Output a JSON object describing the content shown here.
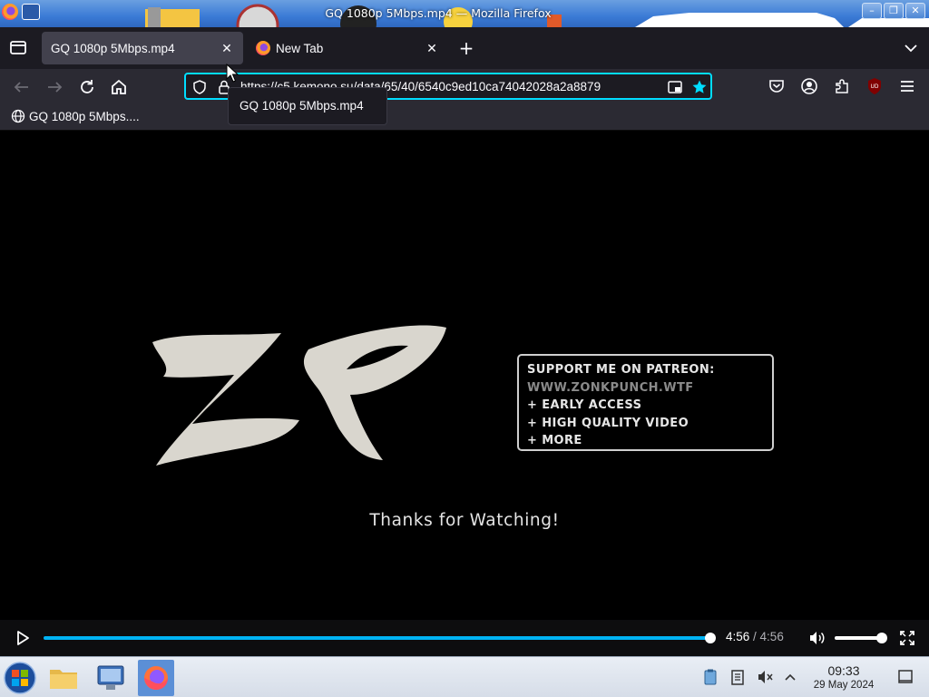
{
  "window": {
    "title": "GQ 1080p 5Mbps.mp4 — Mozilla Firefox",
    "buttons": [
      "minimize",
      "maximize",
      "close"
    ]
  },
  "tabs": [
    {
      "label": "GQ 1080p 5Mbps.mp4",
      "active": true
    },
    {
      "label": "New Tab",
      "active": false
    }
  ],
  "navbar": {
    "url": "https://c5.kemono.su/data/65/40/6540c9ed10ca74042028a2a8879",
    "bookmarked": true
  },
  "bookmarks": [
    {
      "label": "GQ 1080p 5Mbps...."
    }
  ],
  "tooltip": "GQ 1080p 5Mbps.mp4",
  "video": {
    "logo_text": "ZP",
    "patreon_lines": [
      "SUPPORT ME ON PATREON:",
      "WWW.ZONKPUNCH.WTF",
      "+ EARLY ACCESS",
      "+ HIGH QUALITY VIDEO",
      "+ MORE"
    ],
    "thanks": "Thanks for Watching!"
  },
  "player": {
    "current_time": "4:56",
    "separator": " / ",
    "duration": "4:56",
    "progress": 1.0,
    "volume": 1.0,
    "accent": "#00b3f4"
  },
  "taskbar": {
    "clock_time": "09:33",
    "clock_date": "29 May 2024"
  },
  "colors": {
    "toolbar": "#2b2a33",
    "tabstrip": "#1c1b22",
    "focus_ring": "#00ddff"
  }
}
